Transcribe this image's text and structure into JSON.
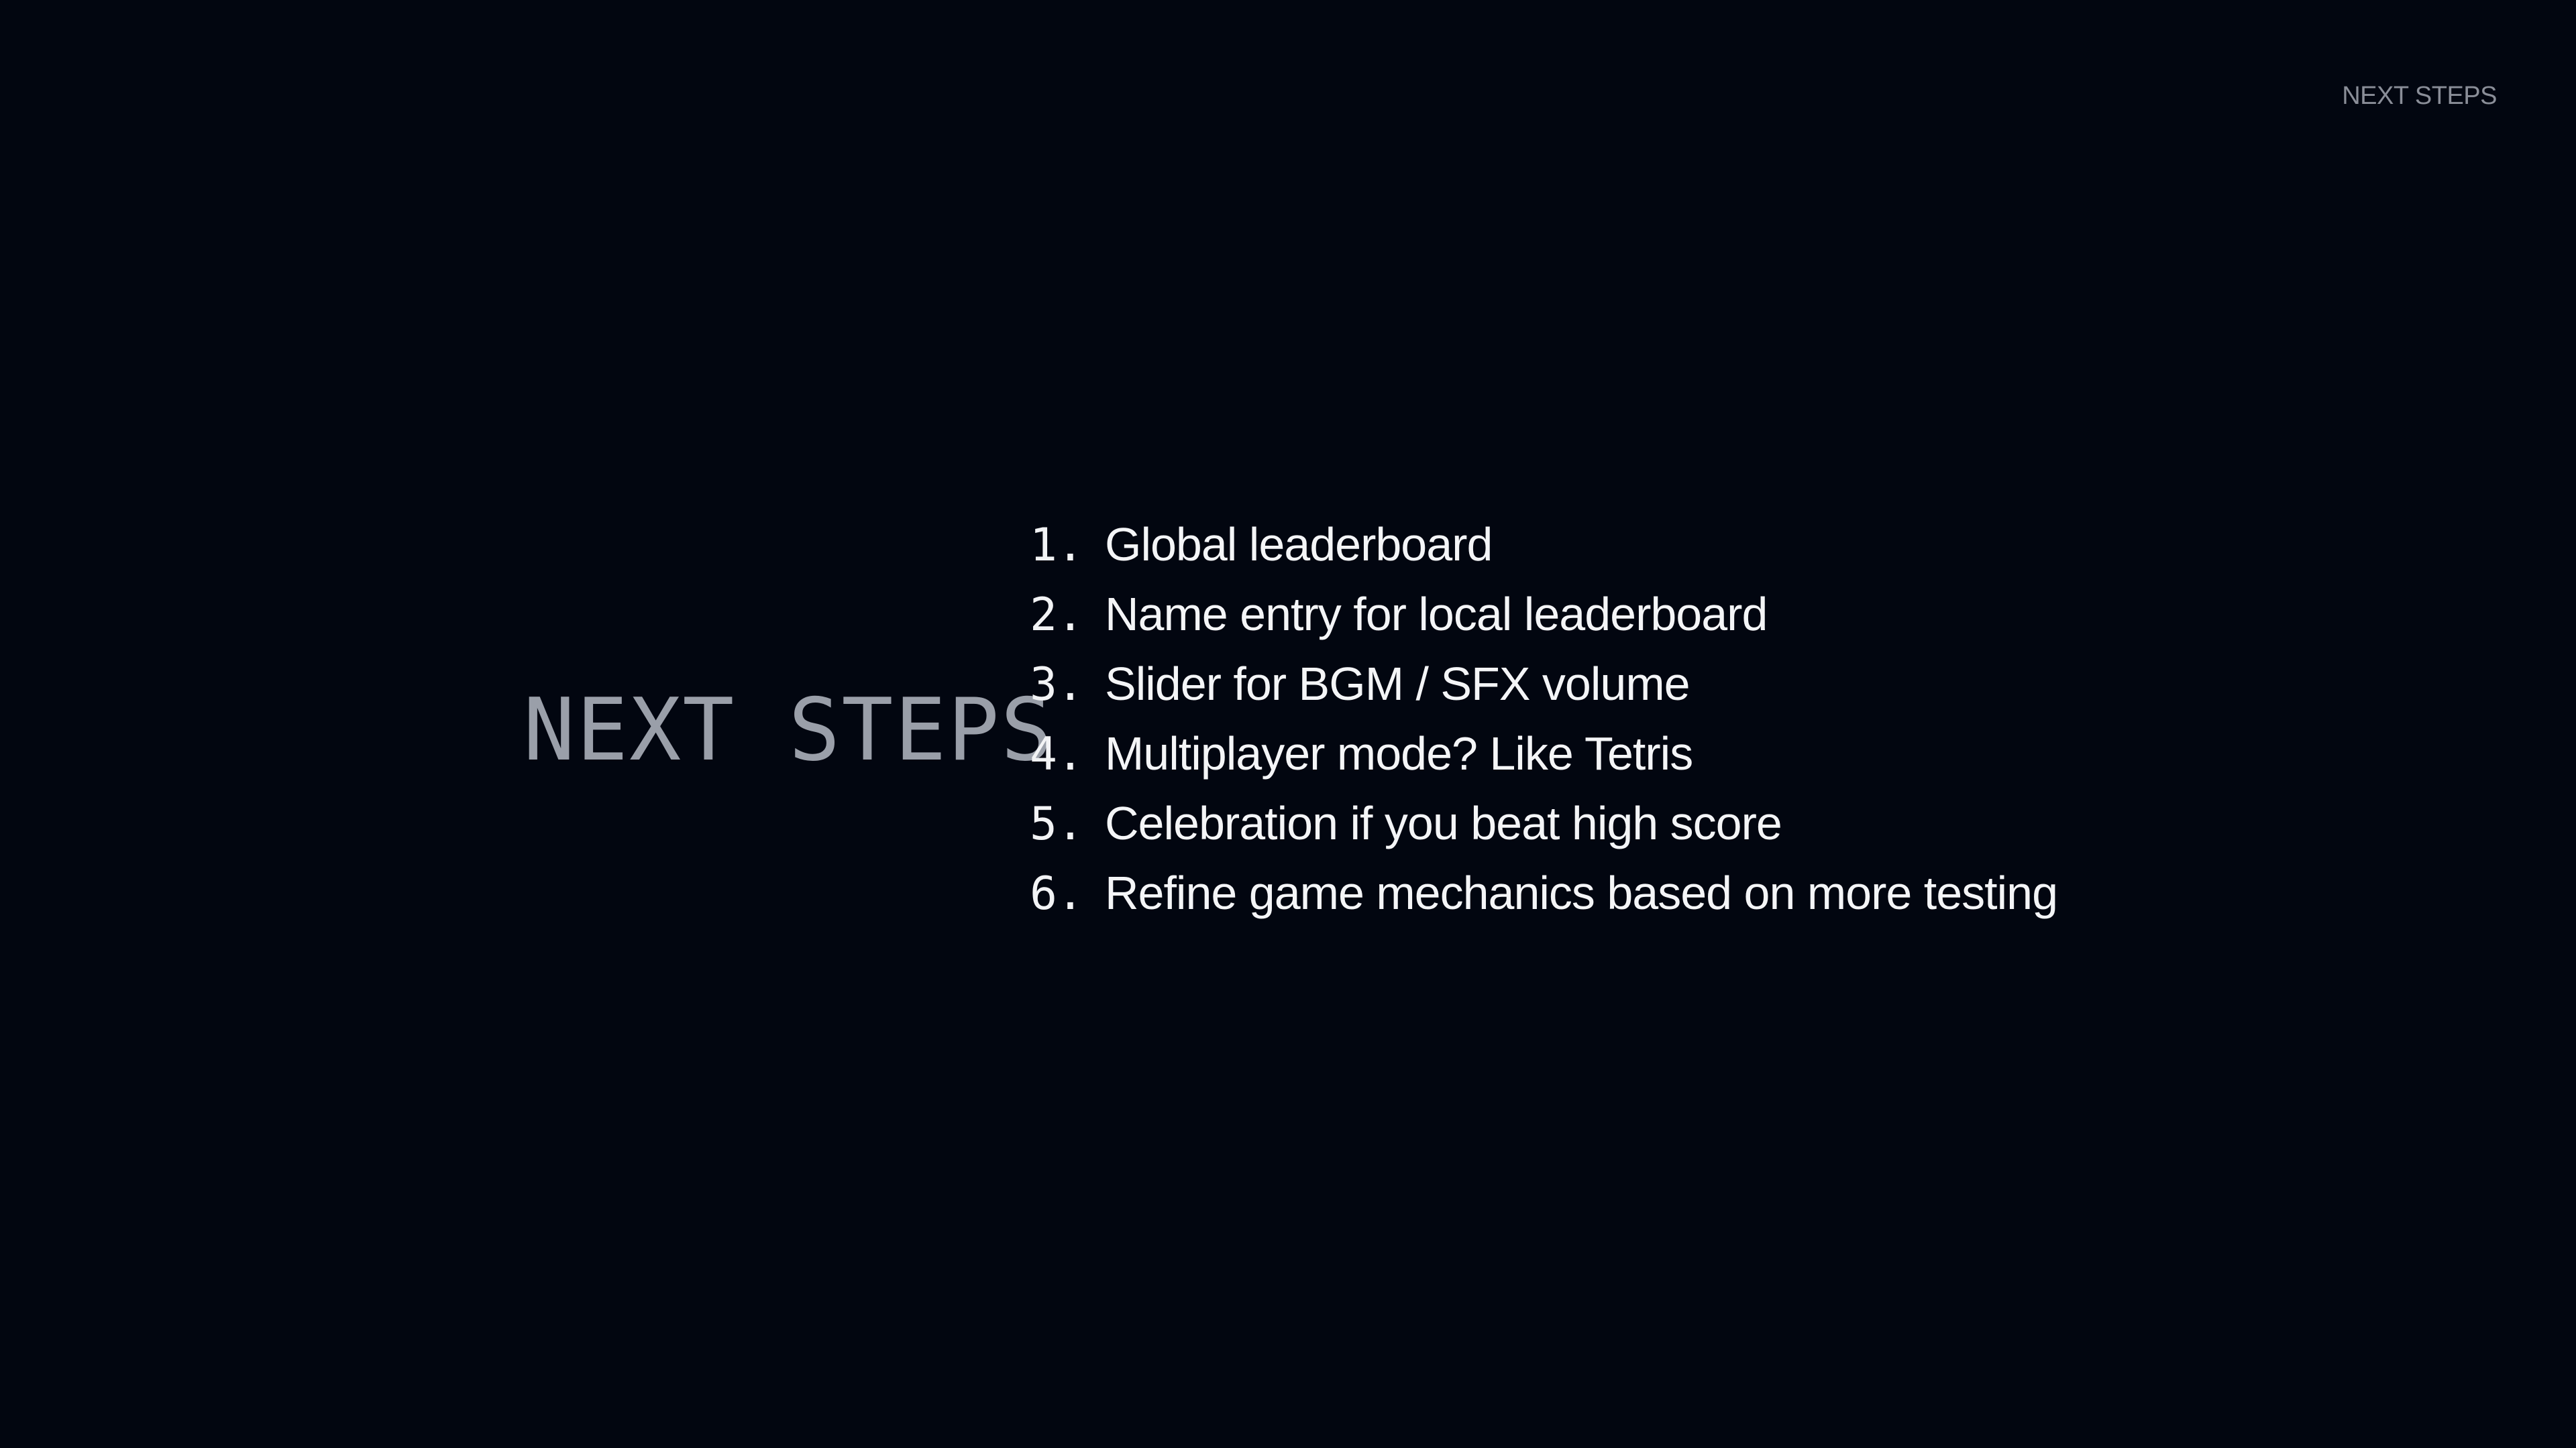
{
  "slide": {
    "header_label": "NEXT STEPS",
    "title": "NEXT STEPS",
    "background_color": "#020610",
    "steps": [
      {
        "number": "1.",
        "text": "Global leaderboard"
      },
      {
        "number": "2.",
        "text": "Name entry for local leaderboard"
      },
      {
        "number": "3.",
        "text": "Slider for BGM / SFX volume"
      },
      {
        "number": "4.",
        "text": "Multiplayer mode? Like Tetris"
      },
      {
        "number": "5.",
        "text": "Celebration if you beat high score"
      },
      {
        "number": "6.",
        "text": "Refine game mechanics based on more testing"
      }
    ]
  }
}
